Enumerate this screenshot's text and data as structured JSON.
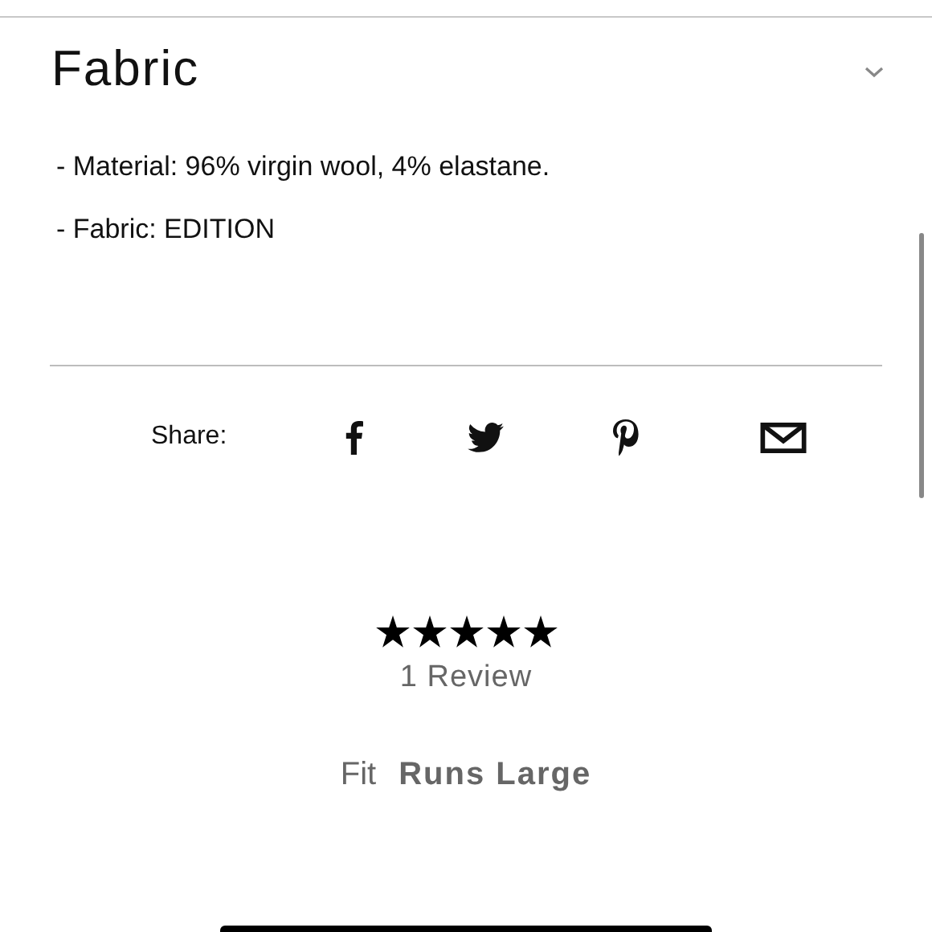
{
  "section": {
    "title": "Fabric",
    "expanded": true,
    "lines": [
      "- Material: 96% virgin wool, 4% elastane.",
      "- Fabric: EDITION"
    ]
  },
  "share": {
    "label": "Share:"
  },
  "reviews": {
    "stars": 5,
    "count": "1 Review"
  },
  "fit": {
    "label": "Fit",
    "value": "Runs Large"
  }
}
